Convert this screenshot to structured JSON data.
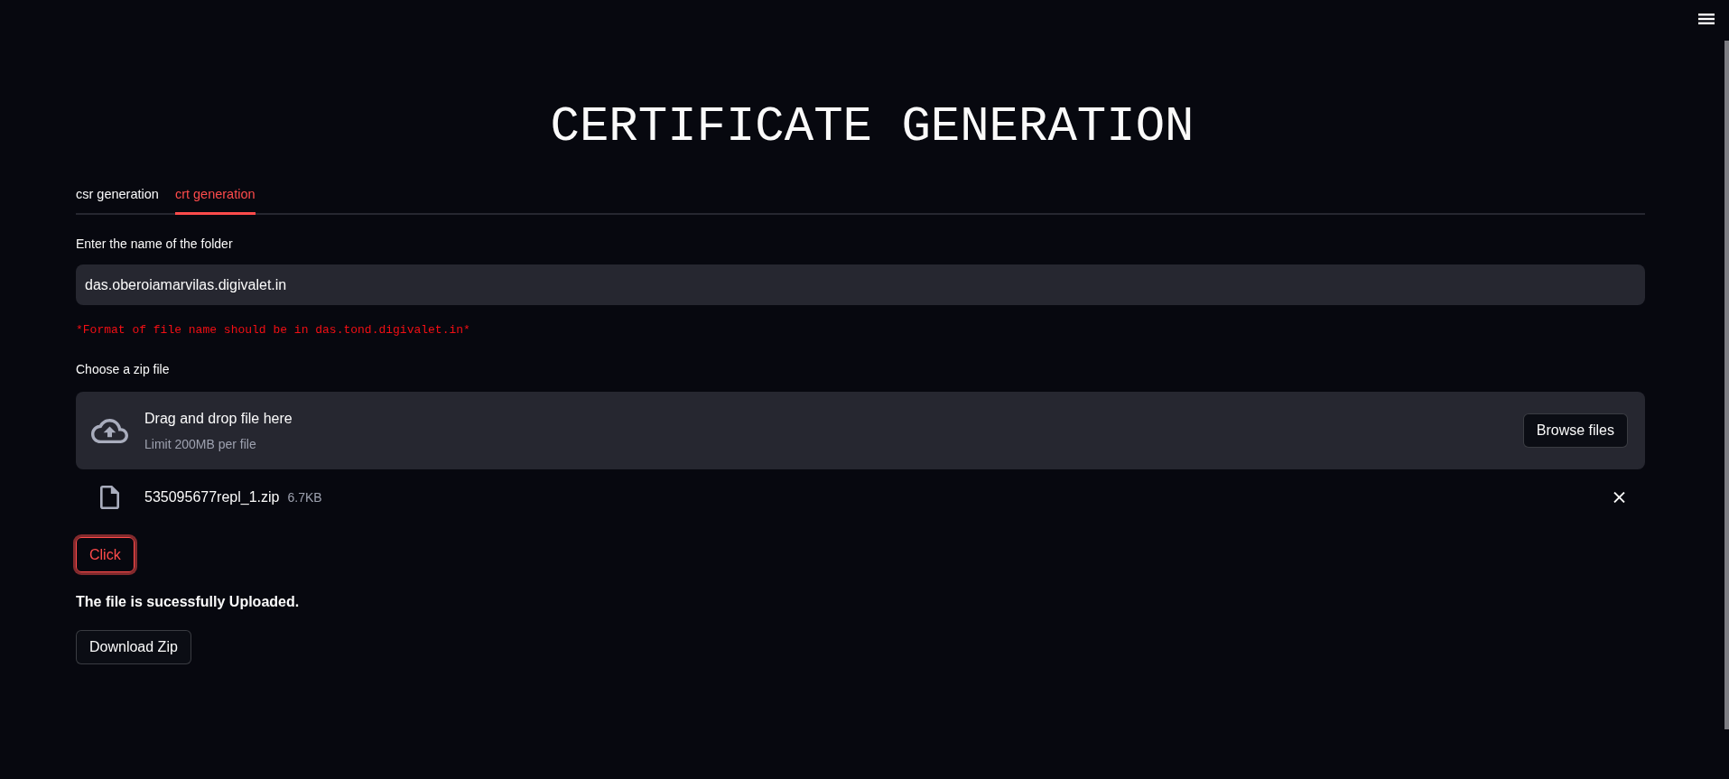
{
  "title": "CERTIFICATE GENERATION",
  "tabs": [
    {
      "label": "csr generation",
      "selected": false
    },
    {
      "label": "crt generation",
      "selected": true
    }
  ],
  "folder_field": {
    "label": "Enter the name of the folder",
    "value": "das.oberoiamarvilas.digivalet.in"
  },
  "format_hint": "*Format of file name should be in das.tond.digivalet.in*",
  "uploader": {
    "label": "Choose a zip file",
    "dropzone_text": "Drag and drop file here",
    "limit": "Limit 200MB per file",
    "browse_button": "Browse files",
    "files": [
      {
        "name": "535095677repl_1.zip",
        "size": "6.7KB"
      }
    ]
  },
  "click_button": {
    "label": "Click",
    "focused": true
  },
  "message": "The file is sucessfully Uploaded.",
  "download_button": {
    "label": "Download Zip"
  }
}
